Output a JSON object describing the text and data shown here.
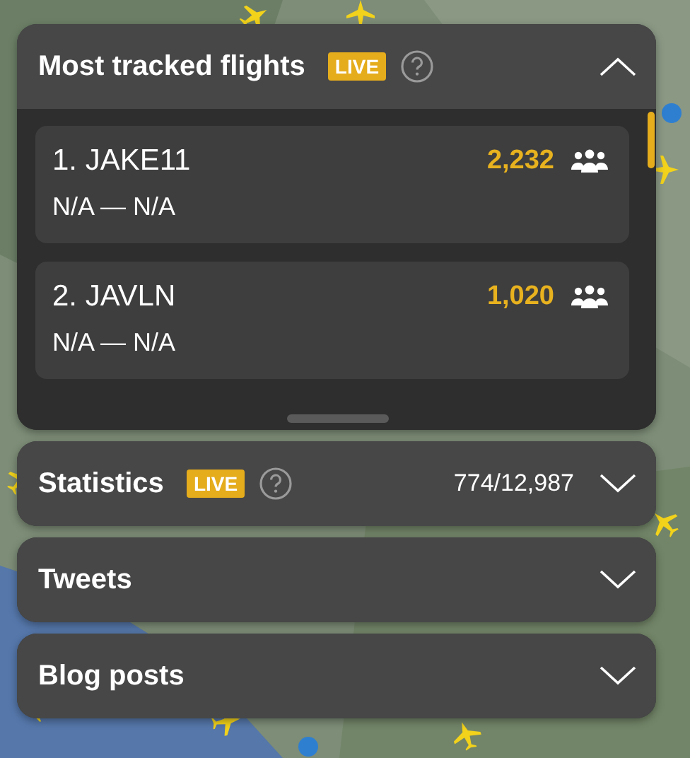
{
  "panels": [
    {
      "kind": "list",
      "title": "Most tracked flights",
      "badge": "LIVE",
      "help": true,
      "expanded": true,
      "flights": [
        {
          "callsign": "1. JAKE11",
          "route": "N/A — N/A",
          "trackers": "2,232"
        },
        {
          "callsign": "2. JAVLN",
          "route": "N/A — N/A",
          "trackers": "1,020"
        }
      ]
    },
    {
      "kind": "summary",
      "title": "Statistics",
      "badge": "LIVE",
      "help": true,
      "expanded": false,
      "count": "774/12,987"
    },
    {
      "kind": "summary",
      "title": "Tweets",
      "expanded": false
    },
    {
      "kind": "summary",
      "title": "Blog posts",
      "expanded": false
    }
  ]
}
